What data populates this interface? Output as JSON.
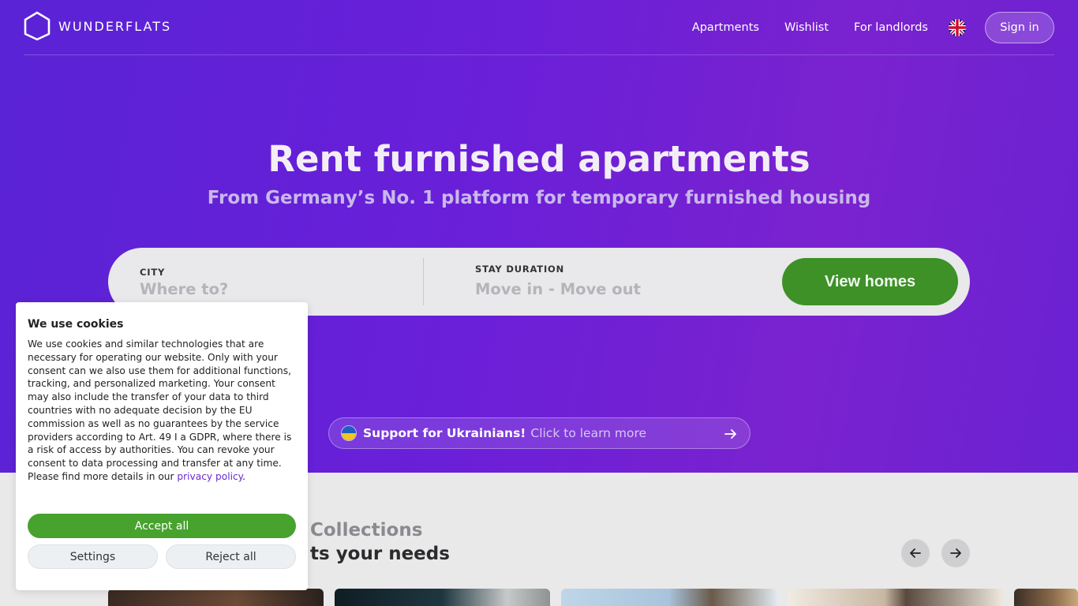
{
  "nav": {
    "logo_text": "WUNDERFLATS",
    "links": [
      "Apartments",
      "Wishlist",
      "For landlords"
    ],
    "sign_in": "Sign in"
  },
  "hero": {
    "title": "Rent furnished apartments",
    "subtitle": "From Germany’s No. 1 platform for temporary furnished housing"
  },
  "search": {
    "city_label": "CITY",
    "city_placeholder": "Where to?",
    "stay_label": "STAY DURATION",
    "stay_placeholder": "Move in - Move out",
    "button": "View homes"
  },
  "banner": {
    "strong": "Support for Ukrainians!",
    "light": "Click to learn more"
  },
  "collections": {
    "title": "Collections",
    "subtitle": "ts your needs"
  },
  "cookie": {
    "title": "We use cookies",
    "body": "We use cookies and similar technologies that are necessary for operating our website. Only with your consent can we also use them for additional functions, tracking, and personalized marketing. Your consent may also include the transfer of your data to third countries with no adequate decision by the EU commission as well as no guarantees by the service providers according to Art. 49 I a GDPR, where there is a risk of access by authorities. You can revoke your consent to data processing and transfer at any time. Please find more details in our ",
    "link": "privacy policy",
    "after_link": ".",
    "accept": "Accept all",
    "settings": "Settings",
    "reject": "Reject all"
  },
  "colors": {
    "hero_purple": "#6a1fd8",
    "cta_green": "#3d9127",
    "accept_green": "#47a22e",
    "link_purple": "#6a2ad1"
  }
}
